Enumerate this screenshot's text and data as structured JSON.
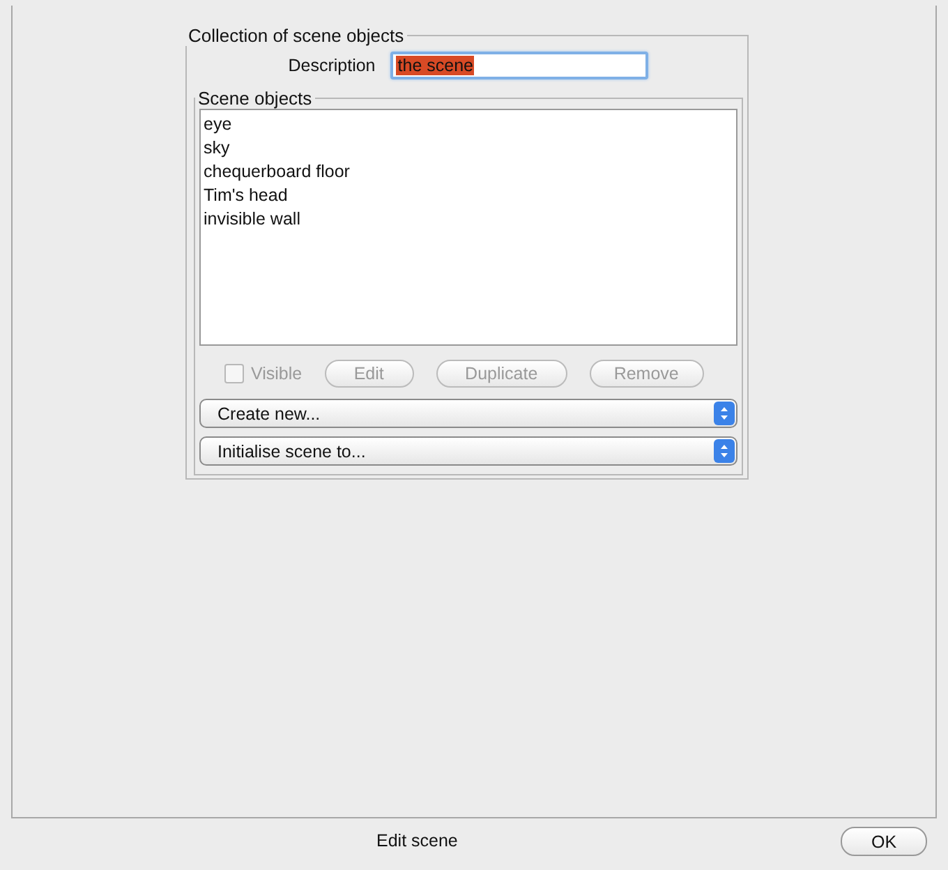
{
  "group": {
    "title": "Collection of scene objects",
    "description": {
      "label": "Description",
      "value": "the scene",
      "text_selected": true
    },
    "scene_objects": {
      "title": "Scene objects",
      "items": [
        {
          "label": "eye",
          "selected": false
        },
        {
          "label": "sky",
          "selected": false
        },
        {
          "label": "chequerboard floor",
          "selected": false
        },
        {
          "label": "Tim's head",
          "selected": false
        },
        {
          "label": "invisible wall",
          "selected": false
        }
      ],
      "visible": {
        "label": "Visible",
        "checked": false,
        "disabled": true
      },
      "buttons": [
        {
          "label": "Edit",
          "disabled": true
        },
        {
          "label": "Duplicate",
          "disabled": true
        },
        {
          "label": "Remove",
          "disabled": true
        }
      ],
      "dropdowns": [
        {
          "value": "Create new..."
        },
        {
          "value": "Initialise scene to..."
        }
      ]
    }
  },
  "status_bar": {
    "title": "Edit scene",
    "ok_button": "OK"
  }
}
